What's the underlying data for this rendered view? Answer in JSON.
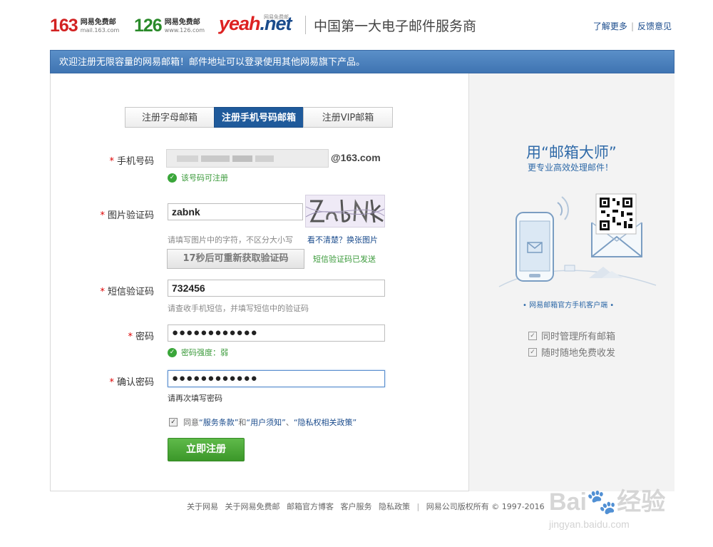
{
  "header": {
    "logos": [
      {
        "num": "163",
        "name": "网易免费邮",
        "domain": "mail.163.com",
        "color": "#d22222"
      },
      {
        "num": "126",
        "name": "网易免费邮",
        "domain": "www.126.com",
        "color": "#2a8a2a"
      }
    ],
    "yeah_main": "yeah",
    "yeah_net": ".net",
    "yeah_tag": "网易免费邮",
    "slogan": "中国第一大电子邮件服务商",
    "links": [
      "了解更多",
      "反馈意见"
    ]
  },
  "banner": "欢迎注册无限容量的网易邮箱！邮件地址可以登录使用其他网易旗下产品。",
  "tabs": [
    {
      "label": "注册字母邮箱",
      "active": false
    },
    {
      "label": "注册手机号码邮箱",
      "active": true
    },
    {
      "label": "注册VIP邮箱",
      "active": false
    }
  ],
  "form": {
    "phone_label": "手机号码",
    "phone_suffix": "@163.com",
    "phone_ok": "该号码可注册",
    "captcha_label": "图片验证码",
    "captcha_value": "zabnk",
    "captcha_hint": "请填写图片中的字符，不区分大小写",
    "captcha_refresh": "看不清楚？换张图片",
    "sms_button": "17秒后可重新获取验证码",
    "sms_sent": "短信验证码已发送",
    "sms_label": "短信验证码",
    "sms_value": "732456",
    "sms_hint": "请查收手机短信，并填写短信中的验证码",
    "pwd_label": "密码",
    "pwd_value": "●●●●●●●●●●●●",
    "pwd_strength": "密码强度：弱",
    "confirm_label": "确认密码",
    "confirm_value": "●●●●●●●●●●●●",
    "confirm_hint": "请再次填写密码",
    "agree_prefix": "同意",
    "agree_terms": "“服务条款”",
    "agree_and": "和",
    "agree_notice": "“用户须知”",
    "agree_sep": "、",
    "agree_privacy": "“隐私权相关政策”",
    "submit": "立即注册"
  },
  "right_pane": {
    "title": "用“邮箱大师”",
    "subtitle": "更专业高效处理邮件！",
    "caption": "• 网易邮箱官方手机客户端 •",
    "features": [
      "同时管理所有邮箱",
      "随时随地免费收发"
    ]
  },
  "footer": {
    "links": [
      "关于网易",
      "关于网易免费邮",
      "邮箱官方博客",
      "客户服务",
      "隐私政策"
    ],
    "copyright": "网易公司版权所有 © 1997-2016"
  },
  "watermark": {
    "main": "Bai",
    "cn": "经验",
    "url": "jingyan.baidu.com"
  }
}
